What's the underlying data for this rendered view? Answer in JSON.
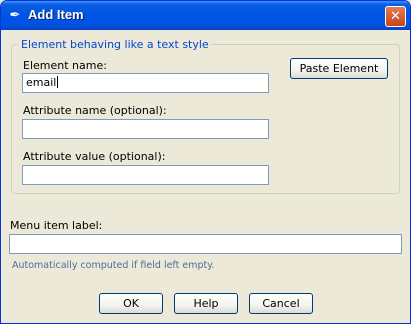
{
  "window": {
    "title": "Add Item",
    "icon": "feather-icon",
    "close_glyph": "✕"
  },
  "group": {
    "legend": "Element behaving like a text style",
    "element_name_label": "Element name:",
    "element_name_value": "email",
    "attribute_name_label": "Attribute name (optional):",
    "attribute_name_value": "",
    "attribute_value_label": "Attribute value (optional):",
    "attribute_value_value": "",
    "paste_element_label": "Paste Element"
  },
  "menu": {
    "label": "Menu item label:",
    "value": "",
    "hint": "Automatically computed if field left empty."
  },
  "buttons": {
    "ok": "OK",
    "help": "Help",
    "cancel": "Cancel"
  },
  "colors": {
    "title_bar": "#0054e3",
    "legend_text": "#0046d5",
    "hint_text": "#4d6d9a",
    "close_button": "#c9421b"
  }
}
